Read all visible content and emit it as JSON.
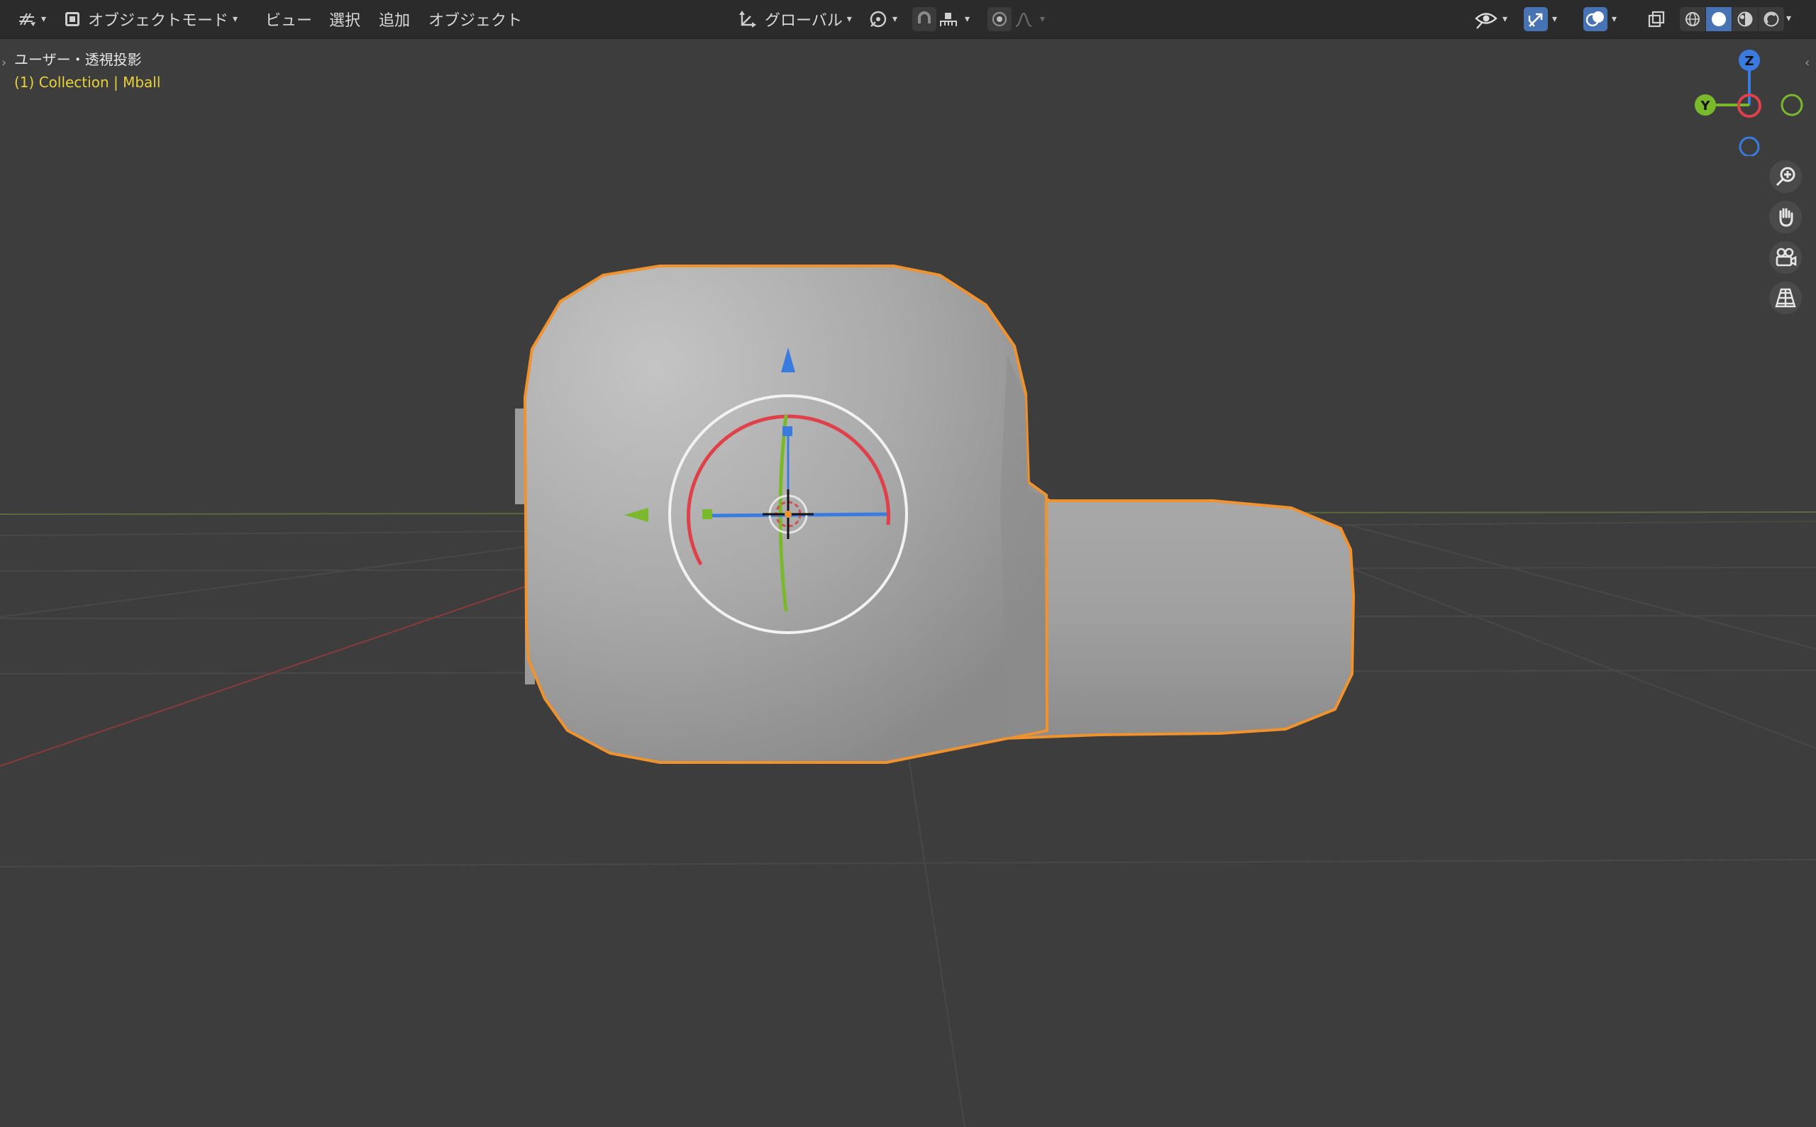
{
  "header": {
    "editor_type_icon": "axes-grid-icon",
    "mode": {
      "icon": "object-mode-square-icon",
      "label": "オブジェクトモード"
    },
    "menus": [
      {
        "label": "ビュー"
      },
      {
        "label": "選択"
      },
      {
        "label": "追加"
      },
      {
        "label": "オブジェクト"
      }
    ],
    "transform_orientation": {
      "icon": "orientation-axes-icon",
      "label": "グローバル"
    },
    "pivot_icon": "pivot-link-icon",
    "snap_icon": "magnet-icon",
    "snap_target_icon": "snap-increment-icon",
    "proportional_icon": "proportional-dot-icon",
    "falloff_icon": "falloff-curve-icon",
    "visibility_icon": "eye-icon",
    "gizmo_icon": "gizmo-arrow-icon",
    "overlay_icon": "overlay-circles-icon",
    "xray_icon": "xray-icon",
    "shading_modes": [
      "wireframe-shading-icon",
      "solid-shading-icon",
      "material-shading-icon",
      "rendered-shading-icon"
    ],
    "active_shading": 1
  },
  "viewport": {
    "view_label": "ユーザー・透視投影",
    "collection_label": "(1) Collection | Mball",
    "selection_color": "#f0922e",
    "x_axis_color": "#e0404a",
    "y_axis_color": "#7ab82c",
    "z_axis_color": "#3a7be0"
  },
  "nav_gizmo": {
    "z_label": "Z",
    "y_label": "Y",
    "tools": [
      {
        "icon": "zoom-icon"
      },
      {
        "icon": "hand-pan-icon"
      },
      {
        "icon": "camera-icon"
      },
      {
        "icon": "perspective-grid-icon"
      }
    ]
  }
}
